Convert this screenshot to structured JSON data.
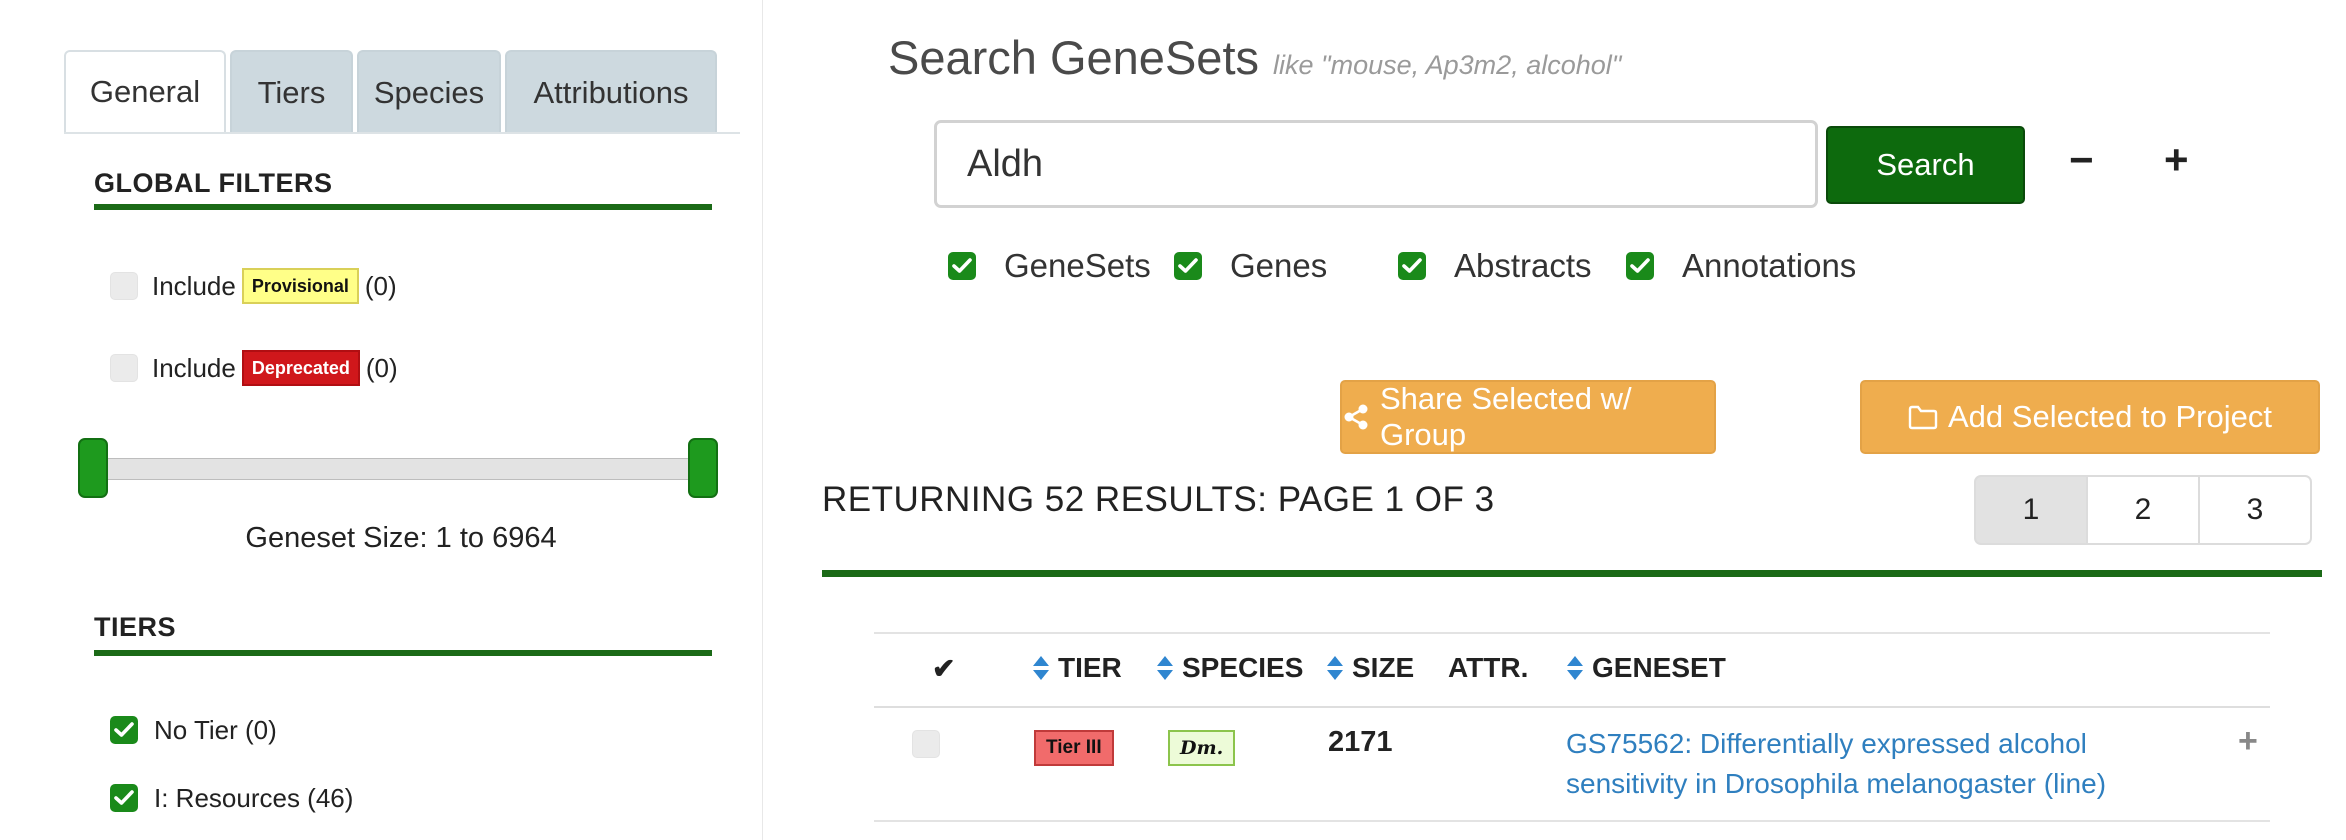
{
  "sidebar": {
    "tabs": [
      {
        "label": "General",
        "active": true
      },
      {
        "label": "Tiers",
        "active": false
      },
      {
        "label": "Species",
        "active": false
      },
      {
        "label": "Attributions",
        "active": false
      }
    ],
    "global_filters": {
      "title": "GLOBAL FILTERS",
      "provisional": {
        "prefix": "Include",
        "badge": "Provisional",
        "count": "(0)",
        "checked": false
      },
      "deprecated": {
        "prefix": "Include",
        "badge": "Deprecated",
        "count": "(0)",
        "checked": false
      },
      "geneset_size": {
        "label": "Geneset Size: 1 to 6964",
        "min": 1,
        "max": 6964
      }
    },
    "tiers": {
      "title": "TIERS",
      "items": [
        {
          "label": "No Tier (0)",
          "checked": true
        },
        {
          "label": "I: Resources (46)",
          "checked": true
        }
      ]
    }
  },
  "search": {
    "title": "Search GeneSets",
    "hint": "like \"mouse, Ap3m2, alcohol\"",
    "value": "Aldh",
    "button_label": "Search",
    "zoom_out": "−",
    "zoom_in": "+",
    "scopes": [
      {
        "label": "GeneSets",
        "checked": true
      },
      {
        "label": "Genes",
        "checked": true
      },
      {
        "label": "Abstracts",
        "checked": true
      },
      {
        "label": "Annotations",
        "checked": true
      }
    ]
  },
  "actions": {
    "share_label": "Share Selected w/ Group",
    "add_label": "Add Selected to Project"
  },
  "results": {
    "summary": "RETURNING 52 RESULTS: PAGE 1 OF 3",
    "pages": [
      "1",
      "2",
      "3"
    ],
    "current_page": "1",
    "columns": {
      "select": "✔",
      "tier": "TIER",
      "species": "SPECIES",
      "size": "SIZE",
      "attr": "ATTR.",
      "geneset": "GENESET"
    },
    "rows": [
      {
        "tier": "Tier III",
        "species": "Dm.",
        "size": "2171",
        "geneset": "GS75562: Differentially expressed alcohol sensitivity in Drosophila melanogaster (line)",
        "row_action": "+"
      }
    ]
  },
  "colors": {
    "brand_green": "#1b6a17",
    "search_button": "#0d6a0d",
    "action_orange": "#efad4e",
    "link_blue": "#2f7fbf",
    "tier3_red": "#f16b6b",
    "deprecated_red": "#d0171b",
    "provisional_yellow": "#ffff88"
  }
}
